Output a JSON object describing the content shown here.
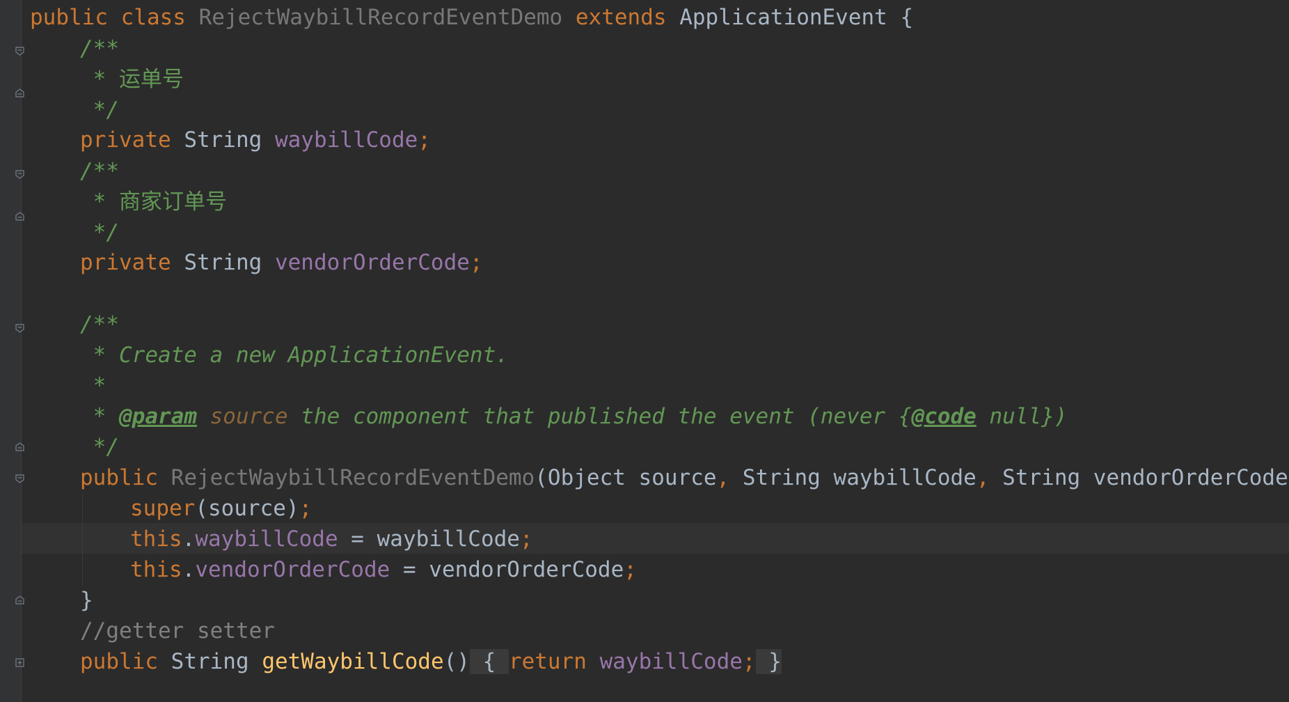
{
  "editor": {
    "background": "#2b2b2b",
    "lines": [
      {
        "k1": "public class ",
        "name": "RejectWaybillRecordEventDemo",
        "k2": " extends ",
        "parent": "ApplicationEvent",
        "brace": " {"
      },
      {
        "text": "/**"
      },
      {
        "text": " * 运单号"
      },
      {
        "text": " */"
      },
      {
        "kw": "private ",
        "type": "String ",
        "field": "waybillCode",
        "semi": ";"
      },
      {
        "text": "/**"
      },
      {
        "text": " * 商家订单号"
      },
      {
        "text": " */"
      },
      {
        "kw": "private ",
        "type": "String ",
        "field": "vendorOrderCode",
        "semi": ";"
      },
      {
        "text": ""
      },
      {
        "text": "/**"
      },
      {
        "text": " * Create a new ApplicationEvent."
      },
      {
        "text": " *"
      },
      {
        "star": " * ",
        "tag": "@param",
        "param": " source",
        "rest": " the component that published the event (never {",
        "code": "@code",
        "tail": " null})"
      },
      {
        "text": " */"
      },
      {
        "kw": "public ",
        "name": "RejectWaybillRecordEventDemo",
        "open": "(Object source",
        "c1": ",",
        "p2": " String waybillCode",
        "c2": ",",
        "p3": " String vendorOrderCode) {"
      },
      {
        "kw": "super",
        "rest": "(source)",
        "semi": ";"
      },
      {
        "kw": "this",
        "dot": ".",
        "field": "waybillCode",
        "rest": " = waybillCode",
        "semi": ";"
      },
      {
        "kw": "this",
        "dot": ".",
        "field": "vendorOrderCode",
        "rest": " = vendorOrderCode",
        "semi": ";"
      },
      {
        "text": "}"
      },
      {
        "text": "//getter setter"
      },
      {
        "kw": "public ",
        "type": "String ",
        "method": "getWaybillCode",
        "parens": "()",
        "ob": " { ",
        "ret": "return ",
        "field": "waybillCode",
        "semi": ";",
        "cb": " }"
      }
    ]
  }
}
